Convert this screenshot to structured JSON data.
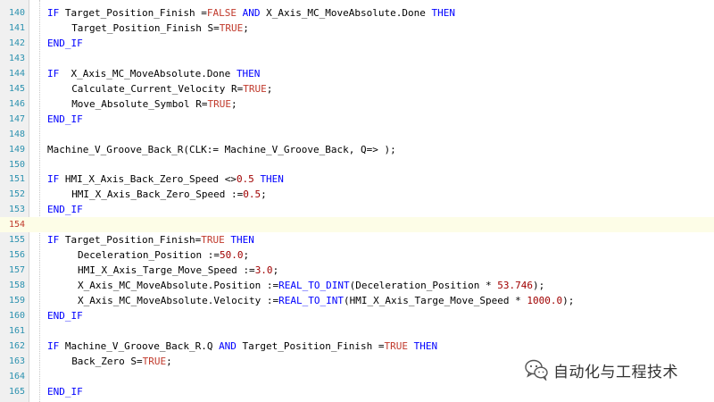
{
  "current_line": "154",
  "colors": {
    "keyword": "#0000ff",
    "literal": "#c0392b",
    "number": "#a00000",
    "line_number": "#2b91af",
    "current_line_bg": "#fdfde7"
  },
  "watermark": {
    "text": "自动化与工程技术",
    "icon": "wechat-icon"
  },
  "lines": [
    {
      "n": "140",
      "indent": 0,
      "tokens": [
        [
          "kw",
          "IF"
        ],
        [
          "id",
          " Target_Position_Finish "
        ],
        [
          "op",
          "="
        ],
        [
          "lit",
          "FALSE"
        ],
        [
          "id",
          " "
        ],
        [
          "kw",
          "AND"
        ],
        [
          "id",
          " X_Axis_MC_MoveAbsolute.Done "
        ],
        [
          "kw",
          "THEN"
        ]
      ]
    },
    {
      "n": "141",
      "indent": 4,
      "tokens": [
        [
          "id",
          "Target_Position_Finish "
        ],
        [
          "op",
          "S="
        ],
        [
          "lit",
          "TRUE"
        ],
        [
          "op",
          ";"
        ]
      ]
    },
    {
      "n": "142",
      "indent": 0,
      "tokens": [
        [
          "kw",
          "END_IF"
        ]
      ]
    },
    {
      "n": "143",
      "indent": 0,
      "tokens": []
    },
    {
      "n": "144",
      "indent": 0,
      "tokens": [
        [
          "kw",
          "IF"
        ],
        [
          "id",
          "  X_Axis_MC_MoveAbsolute.Done "
        ],
        [
          "kw",
          "THEN"
        ]
      ]
    },
    {
      "n": "145",
      "indent": 4,
      "tokens": [
        [
          "id",
          "Calculate_Current_Velocity "
        ],
        [
          "op",
          "R="
        ],
        [
          "lit",
          "TRUE"
        ],
        [
          "op",
          ";"
        ]
      ]
    },
    {
      "n": "146",
      "indent": 4,
      "tokens": [
        [
          "id",
          "Move_Absolute_Symbol "
        ],
        [
          "op",
          "R="
        ],
        [
          "lit",
          "TRUE"
        ],
        [
          "op",
          ";"
        ]
      ]
    },
    {
      "n": "147",
      "indent": 0,
      "tokens": [
        [
          "kw",
          "END_IF"
        ]
      ]
    },
    {
      "n": "148",
      "indent": 0,
      "tokens": []
    },
    {
      "n": "149",
      "indent": 0,
      "tokens": [
        [
          "id",
          "Machine_V_Groove_Back_R(CLK:= Machine_V_Groove_Back, Q=> );"
        ]
      ]
    },
    {
      "n": "150",
      "indent": 0,
      "tokens": []
    },
    {
      "n": "151",
      "indent": 0,
      "tokens": [
        [
          "kw",
          "IF"
        ],
        [
          "id",
          " HMI_X_Axis_Back_Zero_Speed "
        ],
        [
          "op",
          "<>"
        ],
        [
          "num",
          "0.5"
        ],
        [
          "id",
          " "
        ],
        [
          "kw",
          "THEN"
        ]
      ]
    },
    {
      "n": "152",
      "indent": 4,
      "tokens": [
        [
          "id",
          "HMI_X_Axis_Back_Zero_Speed "
        ],
        [
          "op",
          ":="
        ],
        [
          "num",
          "0.5"
        ],
        [
          "op",
          ";"
        ]
      ]
    },
    {
      "n": "153",
      "indent": 0,
      "tokens": [
        [
          "kw",
          "END_IF"
        ]
      ]
    },
    {
      "n": "154",
      "indent": 0,
      "tokens": []
    },
    {
      "n": "155",
      "indent": 0,
      "tokens": [
        [
          "kw",
          "IF"
        ],
        [
          "id",
          " Target_Position_Finish"
        ],
        [
          "op",
          "="
        ],
        [
          "lit",
          "TRUE"
        ],
        [
          "id",
          " "
        ],
        [
          "kw",
          "THEN"
        ]
      ]
    },
    {
      "n": "156",
      "indent": 5,
      "tokens": [
        [
          "id",
          "Deceleration_Position "
        ],
        [
          "op",
          ":="
        ],
        [
          "num",
          "50.0"
        ],
        [
          "op",
          ";"
        ]
      ]
    },
    {
      "n": "157",
      "indent": 5,
      "tokens": [
        [
          "id",
          "HMI_X_Axis_Targe_Move_Speed "
        ],
        [
          "op",
          ":="
        ],
        [
          "num",
          "3.0"
        ],
        [
          "op",
          ";"
        ]
      ]
    },
    {
      "n": "158",
      "indent": 5,
      "tokens": [
        [
          "id",
          "X_Axis_MC_MoveAbsolute.Position "
        ],
        [
          "op",
          ":="
        ],
        [
          "kw",
          "REAL_TO_DINT"
        ],
        [
          "id",
          "(Deceleration_Position "
        ],
        [
          "op",
          "*"
        ],
        [
          "id",
          " "
        ],
        [
          "num",
          "53.746"
        ],
        [
          "id",
          ");"
        ]
      ]
    },
    {
      "n": "159",
      "indent": 5,
      "tokens": [
        [
          "id",
          "X_Axis_MC_MoveAbsolute.Velocity "
        ],
        [
          "op",
          ":="
        ],
        [
          "kw",
          "REAL_TO_INT"
        ],
        [
          "id",
          "(HMI_X_Axis_Targe_Move_Speed "
        ],
        [
          "op",
          "*"
        ],
        [
          "id",
          " "
        ],
        [
          "num",
          "1000.0"
        ],
        [
          "id",
          ");"
        ]
      ]
    },
    {
      "n": "160",
      "indent": 0,
      "tokens": [
        [
          "kw",
          "END_IF"
        ]
      ]
    },
    {
      "n": "161",
      "indent": 0,
      "tokens": []
    },
    {
      "n": "162",
      "indent": 0,
      "tokens": [
        [
          "kw",
          "IF"
        ],
        [
          "id",
          " Machine_V_Groove_Back_R.Q "
        ],
        [
          "kw",
          "AND"
        ],
        [
          "id",
          " Target_Position_Finish "
        ],
        [
          "op",
          "="
        ],
        [
          "lit",
          "TRUE"
        ],
        [
          "id",
          " "
        ],
        [
          "kw",
          "THEN"
        ]
      ]
    },
    {
      "n": "163",
      "indent": 4,
      "tokens": [
        [
          "id",
          "Back_Zero "
        ],
        [
          "op",
          "S="
        ],
        [
          "lit",
          "TRUE"
        ],
        [
          "op",
          ";"
        ]
      ]
    },
    {
      "n": "164",
      "indent": 0,
      "tokens": []
    },
    {
      "n": "165",
      "indent": 0,
      "tokens": [
        [
          "kw",
          "END_IF"
        ]
      ]
    }
  ]
}
